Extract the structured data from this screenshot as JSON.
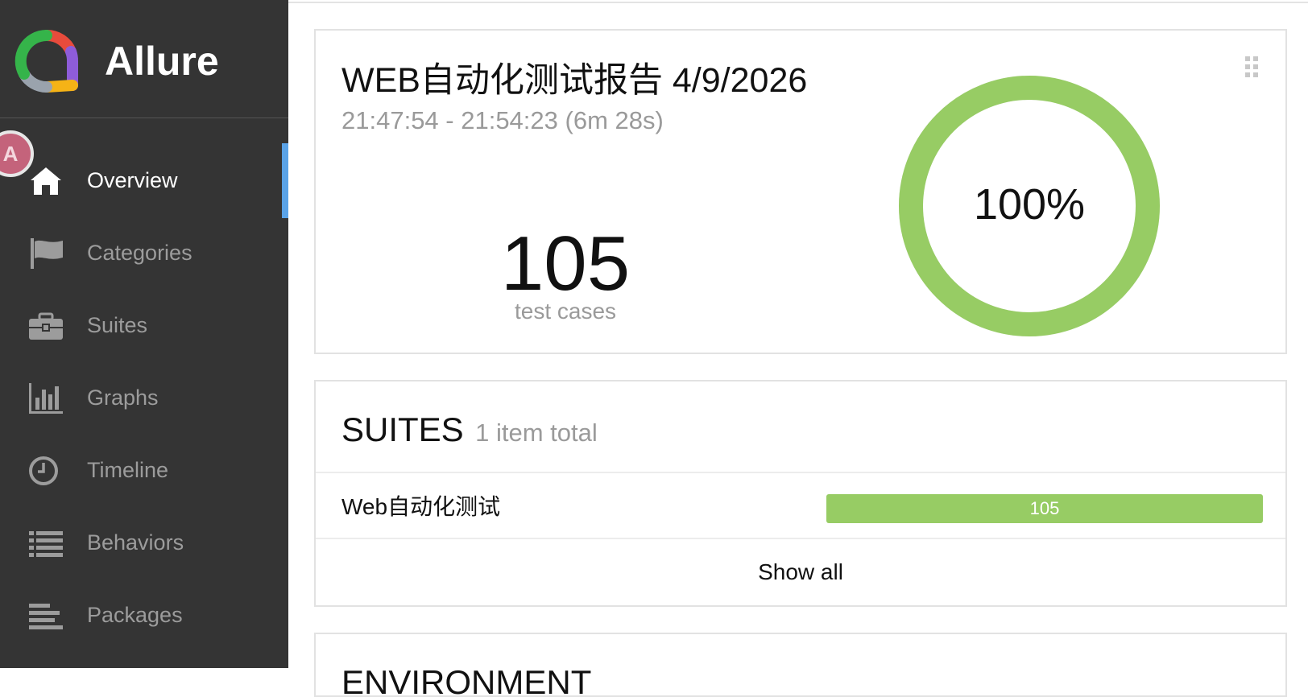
{
  "app": {
    "name": "Allure",
    "avatar_letter": "A"
  },
  "sidebar": {
    "items": [
      {
        "label": "Overview",
        "icon": "home-icon",
        "active": true
      },
      {
        "label": "Categories",
        "icon": "flag-icon",
        "active": false
      },
      {
        "label": "Suites",
        "icon": "briefcase-icon",
        "active": false
      },
      {
        "label": "Graphs",
        "icon": "bar-chart-icon",
        "active": false
      },
      {
        "label": "Timeline",
        "icon": "clock-icon",
        "active": false
      },
      {
        "label": "Behaviors",
        "icon": "list-icon",
        "active": false
      },
      {
        "label": "Packages",
        "icon": "align-left-icon",
        "active": false
      }
    ]
  },
  "summary": {
    "title": "WEB自动化测试报告 4/9/2026",
    "time_range": "21:47:54 - 21:54:23 (6m 28s)",
    "test_count": "105",
    "test_count_label": "test cases",
    "success_rate": "100%",
    "success_fraction": 1.0
  },
  "suites": {
    "title": "SUITES",
    "count_label": "1 item total",
    "items": [
      {
        "name": "Web自动化测试",
        "passed": "105"
      }
    ],
    "show_all": "Show all"
  },
  "environment": {
    "title": "ENVIRONMENT"
  },
  "colors": {
    "sidebar_bg": "#343434",
    "passed": "#97cc64",
    "active_indicator": "#5aa3e8"
  }
}
